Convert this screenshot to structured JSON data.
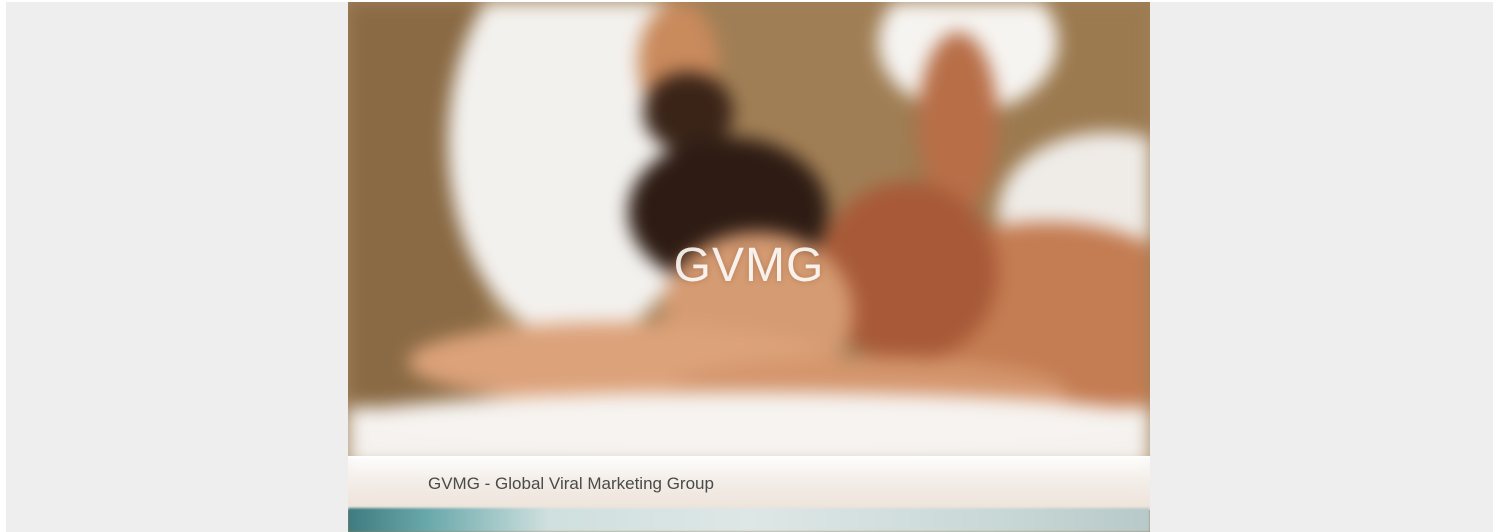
{
  "hero": {
    "title": "GVMG",
    "caption": "GVMG - Global Viral Marketing Group"
  },
  "colors": {
    "page_background": "#eeeeee",
    "title_color": "#ffffff",
    "caption_color": "#4a4a4a"
  }
}
